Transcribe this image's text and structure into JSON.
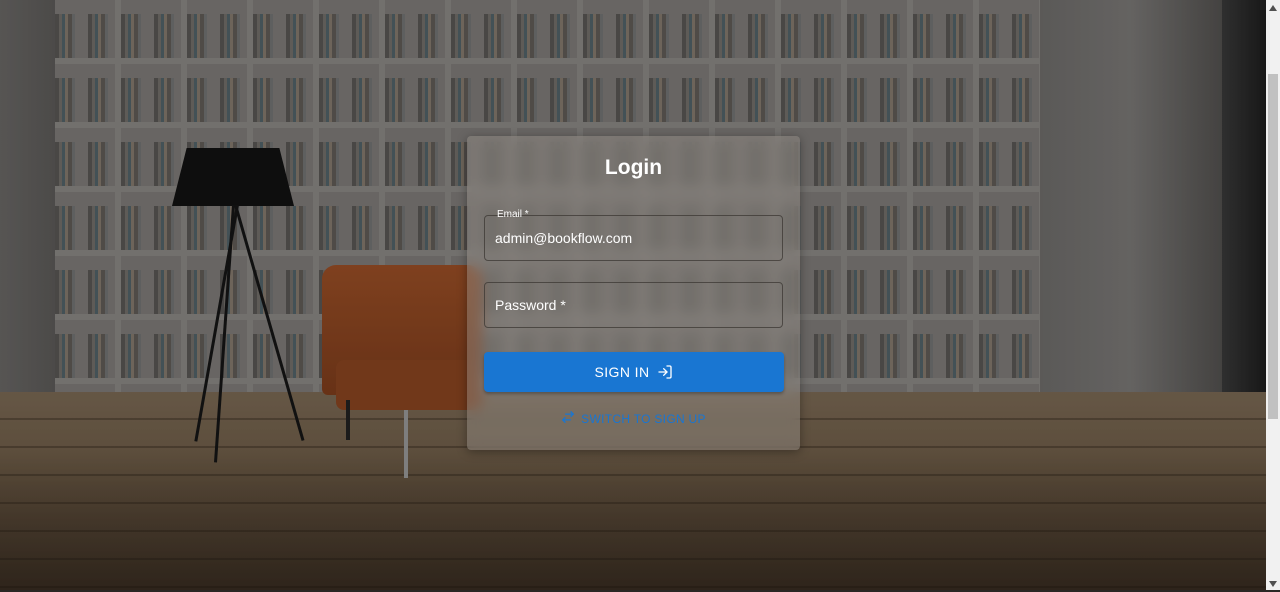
{
  "login": {
    "title": "Login",
    "email": {
      "label": "Email *",
      "value": "admin@bookflow.com"
    },
    "password": {
      "placeholder": "Password *",
      "value": ""
    },
    "sign_in_label": "SIGN IN",
    "switch_label": "SWITCH TO SIGN UP"
  },
  "icons": {
    "sign_in": "login-arrow-icon",
    "switch": "swap-arrows-icon",
    "scroll_up": "chevron-up-icon",
    "scroll_down": "chevron-down-icon"
  },
  "colors": {
    "primary": "#1976d2",
    "card_text": "#ffffff"
  }
}
